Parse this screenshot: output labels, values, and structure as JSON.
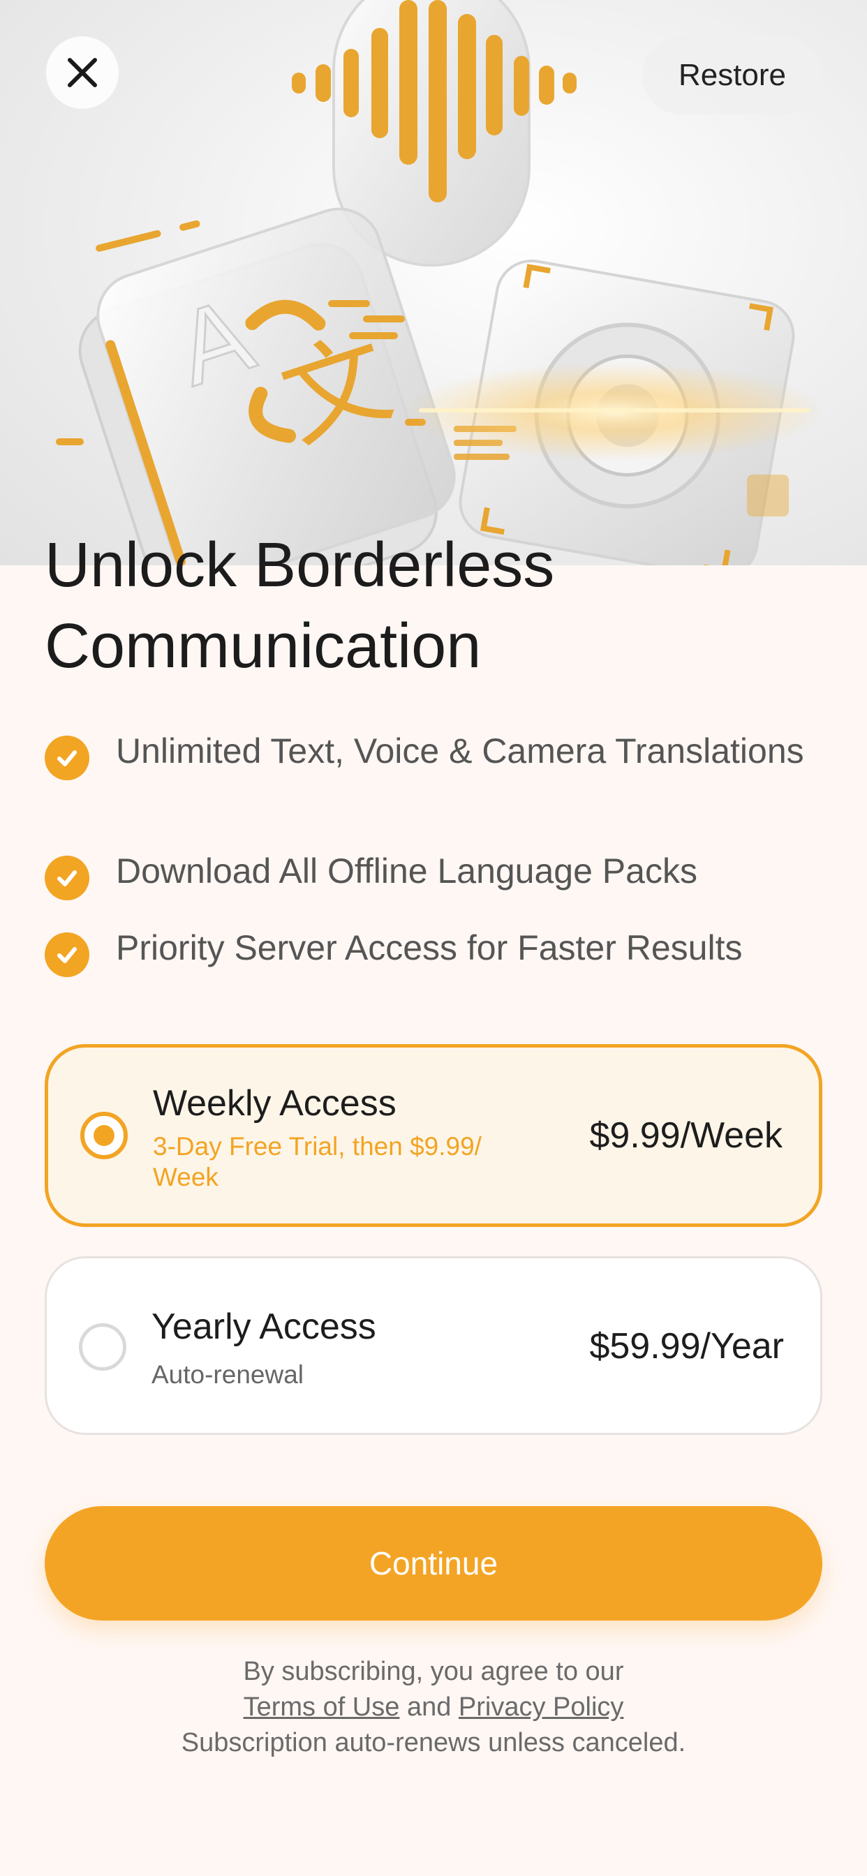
{
  "header": {
    "close_icon": "close-icon",
    "restore_label": "Restore"
  },
  "hero": {
    "illustration": "translation-app-illustration",
    "accent_color": "#f2a423"
  },
  "title": {
    "line1": "Unlock Borderless",
    "line2": "Communication"
  },
  "features": [
    {
      "icon": "check-circle-icon",
      "text": "Unlimited Text, Voice & Camera Translations"
    },
    {
      "icon": "check-circle-icon",
      "text": "Download All Offline Language Packs"
    },
    {
      "icon": "check-circle-icon",
      "text": "Priority Server Access for Faster Results"
    }
  ],
  "plans": [
    {
      "name": "Weekly Access",
      "subtitle": "3-Day Free Trial, then $9.99/ Week",
      "price": "$9.99/Week",
      "selected": true
    },
    {
      "name": "Yearly Access",
      "subtitle": "Auto-renewal",
      "price": "$59.99/Year",
      "selected": false
    }
  ],
  "cta": {
    "label": "Continue"
  },
  "legal": {
    "line1": "By subscribing, you agree to our",
    "terms": "Terms of Use",
    "and": "and",
    "privacy": "Privacy Policy",
    "line3": "Subscription auto-renews unless canceled."
  },
  "colors": {
    "accent": "#f2a423",
    "background": "#fff7f4"
  }
}
